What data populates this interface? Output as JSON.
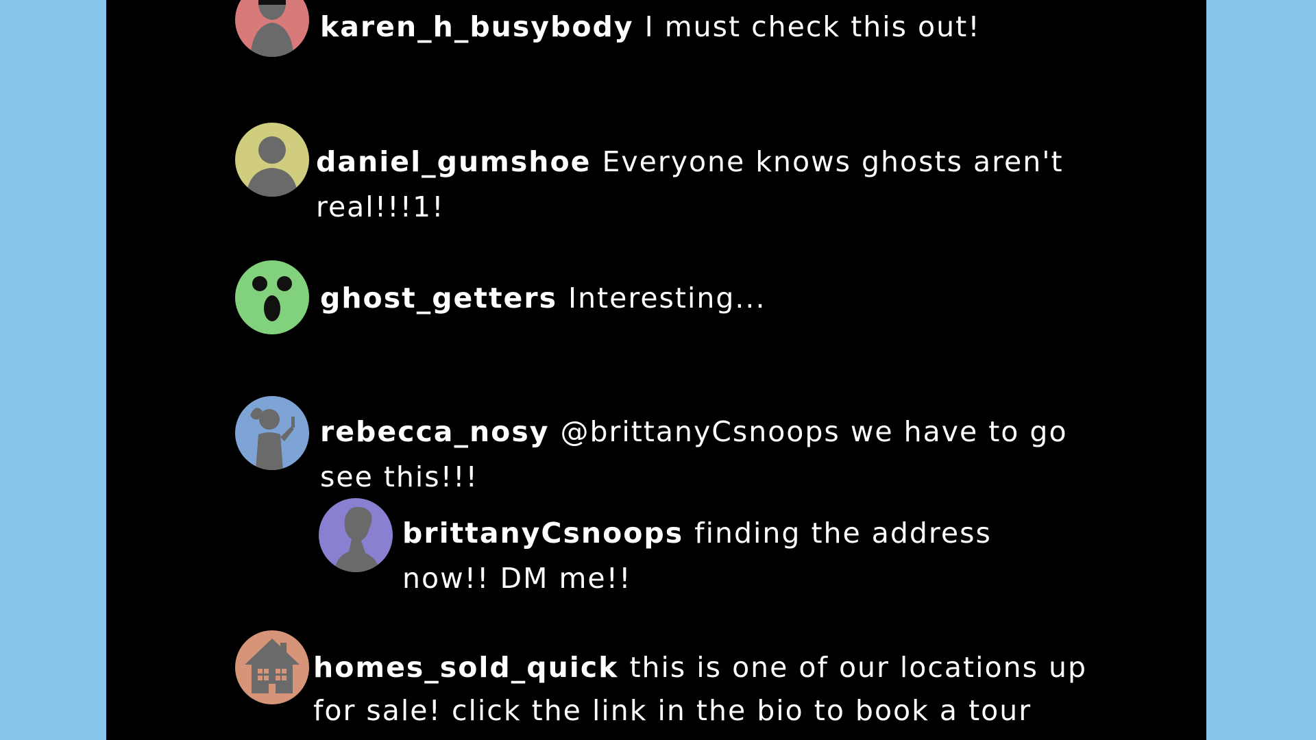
{
  "comments": [
    {
      "username": "karen_h_busybody",
      "text": "I must check this out!",
      "avatar_color": "#d97a7a",
      "avatar_icon": "woman-sunglasses-icon"
    },
    {
      "username": "daniel_gumshoe",
      "text": "Everyone knows ghosts aren't real!!!1!",
      "avatar_color": "#d1cd7e",
      "avatar_icon": "person-icon"
    },
    {
      "username": "ghost_getters",
      "text": "Interesting...",
      "avatar_color": "#82d27d",
      "avatar_icon": "ghost-face-icon"
    },
    {
      "username": "rebecca_nosy",
      "text": "@brittanyCsnoops we have to go see this!!!",
      "avatar_color": "#7ea4d6",
      "avatar_icon": "woman-waving-icon"
    },
    {
      "username": "brittanyCsnoops",
      "text": "finding the address now!! DM me!!",
      "avatar_color": "#8a80d2",
      "avatar_icon": "woman-profile-icon"
    },
    {
      "username": "homes_sold_quick",
      "text": "this is one of our locations up for sale! click the link in the bio to book a tour now &",
      "avatar_color": "#d69479",
      "avatar_icon": "house-icon"
    }
  ]
}
